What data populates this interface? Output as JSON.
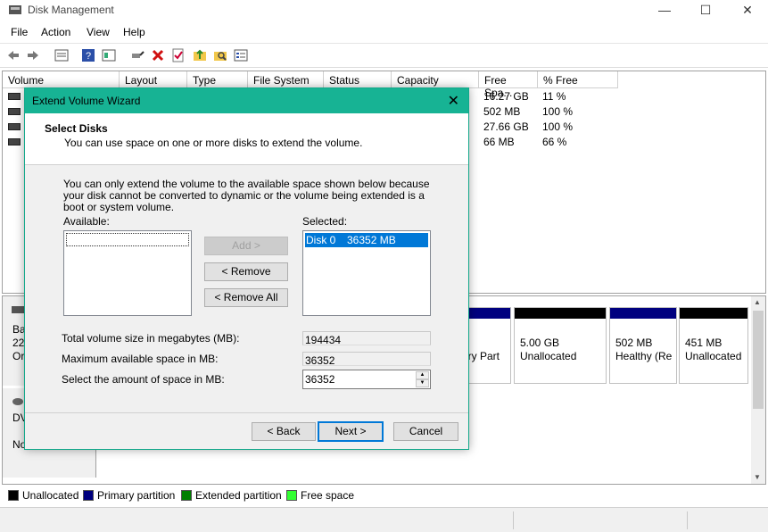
{
  "window": {
    "title": "Disk Management"
  },
  "menu": [
    "File",
    "Action",
    "View",
    "Help"
  ],
  "columns": [
    "Volume",
    "Layout",
    "Type",
    "File System",
    "Status",
    "Capacity",
    "Free Spa...",
    "% Free"
  ],
  "volumes": [
    {
      "free": "16.27 GB",
      "pct": "11 %"
    },
    {
      "free": "502 MB",
      "pct": "100 %"
    },
    {
      "free": "27.66 GB",
      "pct": "100 %"
    },
    {
      "free": "66 MB",
      "pct": "66 %"
    }
  ],
  "disks": [
    {
      "label1": "Ba",
      "label2": "22",
      "label3": "Or"
    },
    {
      "label1": "DV",
      "label2": "No"
    }
  ],
  "partitions": [
    {
      "line1": "ary Part",
      "line2": ""
    },
    {
      "line1": "5.00 GB",
      "line2": "Unallocated"
    },
    {
      "line1": "502 MB",
      "line2": "Healthy (Re"
    },
    {
      "line1": "451 MB",
      "line2": "Unallocated"
    }
  ],
  "legend": [
    {
      "label": "Unallocated",
      "color": "#000000"
    },
    {
      "label": "Primary partition",
      "color": "#00007f"
    },
    {
      "label": "Extended partition",
      "color": "#007f00"
    },
    {
      "label": "Free space",
      "color": "#33ff33"
    }
  ],
  "dialog": {
    "title": "Extend Volume Wizard",
    "heading": "Select Disks",
    "subheading": "You can use space on one or more disks to extend the volume.",
    "info": "You can only extend the volume to the available space shown below because your disk cannot be converted to dynamic or the volume being extended is a boot or system volume.",
    "available_label": "Available:",
    "selected_label": "Selected:",
    "selected_items": [
      {
        "disk": "Disk 0",
        "size": "36352 MB"
      }
    ],
    "add_label": "Add >",
    "remove_label": "< Remove",
    "remove_all_label": "< Remove All",
    "total_label": "Total volume size in megabytes (MB):",
    "total_value": "194434",
    "max_label": "Maximum available space in MB:",
    "max_value": "36352",
    "amount_label": "Select the amount of space in MB:",
    "amount_value": "36352",
    "back_label": "< Back",
    "next_label": "Next >",
    "cancel_label": "Cancel"
  },
  "colors": {
    "dialog_accent": "#17b394",
    "selection": "#0078d7"
  }
}
